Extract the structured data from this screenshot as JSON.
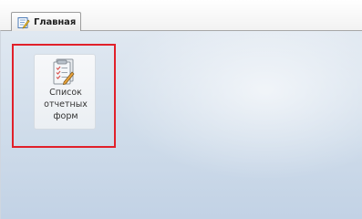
{
  "tabs": [
    {
      "label": "Главная",
      "icon": "edit-document-icon",
      "active": true
    }
  ],
  "desktop": {
    "items": [
      {
        "label_lines": [
          "Список",
          "отчетных",
          "форм"
        ],
        "icon": "report-forms-icon",
        "highlighted": true
      }
    ]
  },
  "colors": {
    "highlight": "#e1202a",
    "background_top": "#e0e8f1",
    "background_bottom": "#c2d2e5"
  }
}
